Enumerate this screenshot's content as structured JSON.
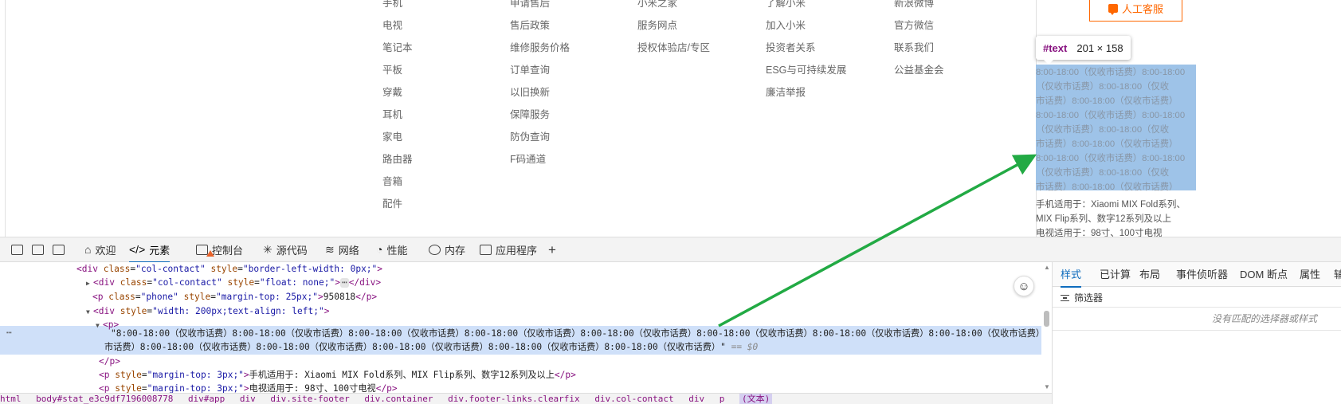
{
  "footer": {
    "columns": [
      {
        "items": [
          "手机",
          "电视",
          "笔记本",
          "平板",
          "穿戴",
          "耳机",
          "家电",
          "路由器",
          "音箱",
          "配件"
        ]
      },
      {
        "items": [
          "申请售后",
          "售后政策",
          "维修服务价格",
          "订单查询",
          "以旧换新",
          "保障服务",
          "防伪查询",
          "F码通道"
        ]
      },
      {
        "items": [
          "小米之家",
          "服务网点",
          "授权体验店/专区"
        ]
      },
      {
        "items": [
          "了解小米",
          "加入小米",
          "投资者关系",
          "ESG与可持续发展",
          "廉洁举报"
        ]
      },
      {
        "items": [
          "新浪微博",
          "官方微信",
          "联系我们",
          "公益基金会"
        ]
      }
    ],
    "service_button": "人工客服",
    "phone": "950818",
    "phone_visible": "0818",
    "hours_lines": [
      "8:00-18:00（仅收市话费）8:00-18:00",
      "（仅收市话费）8:00-18:00（仅收",
      "市话费）8:00-18:00（仅收市话费）",
      "8:00-18:00（仅收市话费）8:00-18:00",
      "（仅收市话费）8:00-18:00（仅收",
      "市话费）8:00-18:00（仅收市话费）",
      "8:00-18:00（仅收市话费）8:00-18:00",
      "（仅收市话费）8:00-18:00（仅收",
      "市话费）8:00-18:00（仅收市话费）"
    ],
    "apply_lines": [
      "手机适用于：Xiaomi MIX Fold系列、",
      "MIX Flip系列、数字12系列及以上",
      "电视适用于：98寸、100寸电视"
    ]
  },
  "tooltip": {
    "tag": "#text",
    "size": "201 × 158"
  },
  "devtools": {
    "tabs": [
      "欢迎",
      "元素",
      "控制台",
      "源代码",
      "网络",
      "性能",
      "内存",
      "应用程序",
      "+"
    ],
    "dom": {
      "l1": {
        "tag": "<div",
        "attr": "class",
        "val": "\"col-contact\"",
        "attr2": "style",
        "val2": "\"border-left-width: 0px;\"",
        "end": ">"
      },
      "l2": {
        "tag": "<div",
        "attr": "class",
        "val": "\"col-contact\"",
        "attr2": "style",
        "val2": "\"float: none;\"",
        "mid": ">",
        "ellipsis": "⋯",
        "close": "</div>"
      },
      "l3": {
        "tag": "<p",
        "attr": "class",
        "val": "\"phone\"",
        "attr2": "style",
        "val2": "\"margin-top: 25px;\"",
        "mid": ">",
        "text": "950818",
        "close": "</p>"
      },
      "l4": {
        "tag": "<div",
        "attr": "style",
        "val": "\"width: 200px;text-align: left;\"",
        "end": ">"
      },
      "l5": {
        "tag": "<p>"
      },
      "sel1": "\"8:00-18:00（仅收市话费）8:00-18:00（仅收市话费）8:00-18:00（仅收市话费）8:00-18:00（仅收市话费）8:00-18:00（仅收市话费）8:00-18:00（仅收市话费）8:00-18:00（仅收市话费）8:00-18:00（仅收市话费）8:00-18:00（仅收",
      "sel2": "市话费）8:00-18:00（仅收市话费）8:00-18:00（仅收市话费）8:00-18:00（仅收市话费）8:00-18:00（仅收市话费）8:00-18:00（仅收市话费）\"",
      "sel_eq": "== $0",
      "more": "⋯",
      "l7": {
        "tag": "</p>"
      },
      "l8": {
        "tag": "<p",
        "attr": "style",
        "val": "\"margin-top: 3px;\"",
        "mid": ">",
        "text": "手机适用于: Xiaomi MIX Fold系列、MIX Flip系列、数字12系列及以上",
        "close": "</p>"
      },
      "l9": {
        "tag": "<p",
        "attr": "style",
        "val": "\"margin-top: 3px;\"",
        "mid": ">",
        "text": "电视适用于: 98寸、100寸电视",
        "close": "</p>"
      }
    },
    "side_tabs": [
      "样式",
      "已计算",
      "布局",
      "事件侦听器",
      "DOM 断点",
      "属性",
      "辅"
    ],
    "filter": "筛选器",
    "no_match": "没有匹配的选择器或样式",
    "breadcrumbs": [
      "html",
      "body#stat_e3c9df7196008778",
      "div#app",
      "div",
      "div.site-footer",
      "div.container",
      "div.footer-links.clearfix",
      "div.col-contact",
      "div",
      "p",
      "(文本)"
    ]
  },
  "annotation": {
    "arrow_color": "#22aa44"
  },
  "colors": {
    "accent": "#ff6700",
    "devtools_blue": "#0f6cbd",
    "tag": "#881280",
    "attr_name": "#994500",
    "attr_value": "#1a1aa6",
    "selection": "#cfe0f9"
  }
}
